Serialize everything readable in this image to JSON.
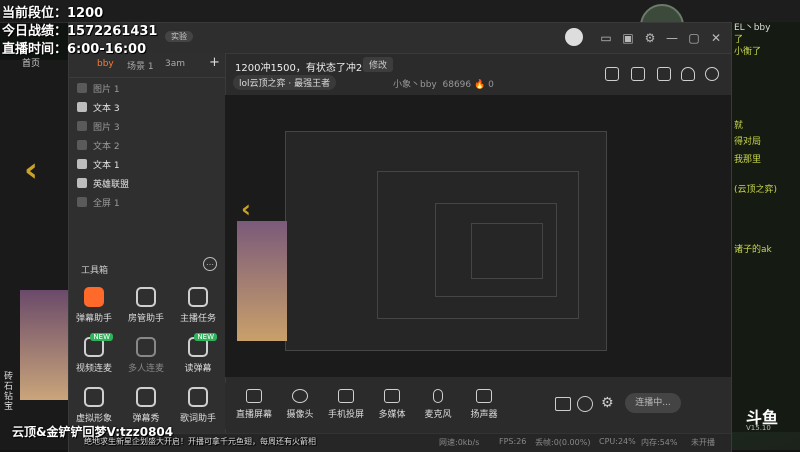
{
  "osd": {
    "rank_line": "当前段位：1200",
    "record_line": "今日战绩：1572261431",
    "time_line": "直播时间：6:00-16:00",
    "bottom_watermark": "云顶&金铲铲回梦V:tzz0804",
    "bottom_ticker": "绝地求生新星企划盛大开启！开播可拿千元鱼翅，每周还有火箭相"
  },
  "background": {
    "home_label": "首页",
    "side_label_1": "砖石",
    "side_label_2": "钻宝",
    "chat_lines": [
      "EL丶bby",
      "了",
      "小衡了",
      "就",
      "得对局",
      "我那里",
      "(云顶之弈)",
      "诸子的ak"
    ],
    "brand": "斗鱼",
    "brand_sub": "DOUYU.COM",
    "version": "V15.10"
  },
  "window": {
    "badge": "实验",
    "controls": [
      "screen-icon",
      "window-icon",
      "min-icon",
      "max-icon",
      "close-icon"
    ]
  },
  "scenes": {
    "tabs": [
      "bby",
      "场景 1",
      "3am"
    ],
    "add": "+"
  },
  "sources": [
    {
      "label": "图片 1",
      "on": false
    },
    {
      "label": "文本 3",
      "on": true
    },
    {
      "label": "图片 3",
      "on": false
    },
    {
      "label": "文本 2",
      "on": false
    },
    {
      "label": "文本 1",
      "on": true
    },
    {
      "label": "英雄联盟",
      "on": true
    },
    {
      "label": "全屏 1",
      "on": false
    }
  ],
  "toolbox": {
    "title": "工具箱",
    "more": "…",
    "items": [
      {
        "label": "弹幕助手",
        "hot": true,
        "badge": ""
      },
      {
        "label": "房管助手",
        "hot": false,
        "badge": ""
      },
      {
        "label": "主播任务",
        "hot": false,
        "badge": ""
      },
      {
        "label": "视频连麦",
        "hot": false,
        "badge": "NEW"
      },
      {
        "label": "多人连麦",
        "hot": false,
        "badge": ""
      },
      {
        "label": "读弹幕",
        "hot": false,
        "badge": "NEW"
      },
      {
        "label": "虚拟形象",
        "hot": false,
        "badge": ""
      },
      {
        "label": "弹幕秀",
        "hot": false,
        "badge": ""
      },
      {
        "label": "歌词助手",
        "hot": false,
        "badge": ""
      }
    ]
  },
  "room": {
    "title": "1200冲1500，有状态了冲2000",
    "edit": "修改",
    "category": "lol云顶之弈 · 最强王者",
    "owner": "小象丶bby",
    "room_id": "68696",
    "heat": "0"
  },
  "bottom_tools": [
    {
      "label": "直播屏幕",
      "icon": "screen-share-icon"
    },
    {
      "label": "摄像头",
      "icon": "camera-icon"
    },
    {
      "label": "手机投屏",
      "icon": "phone-icon"
    },
    {
      "label": "多媒体",
      "icon": "media-icon"
    },
    {
      "label": "麦克风",
      "icon": "mic-icon"
    },
    {
      "label": "扬声器",
      "icon": "speaker-icon"
    }
  ],
  "live_button": "连播中...",
  "status": {
    "net": "网速:0kb/s",
    "fps": "FPS:26",
    "drop": "丢帧:0(0.00%)",
    "cpu": "CPU:24%",
    "mem": "内存:54%",
    "rec": "未开播"
  },
  "colors": {
    "accent": "#ff6a2a",
    "osd_text": "#ffffff",
    "chat": "#c8d84a"
  }
}
